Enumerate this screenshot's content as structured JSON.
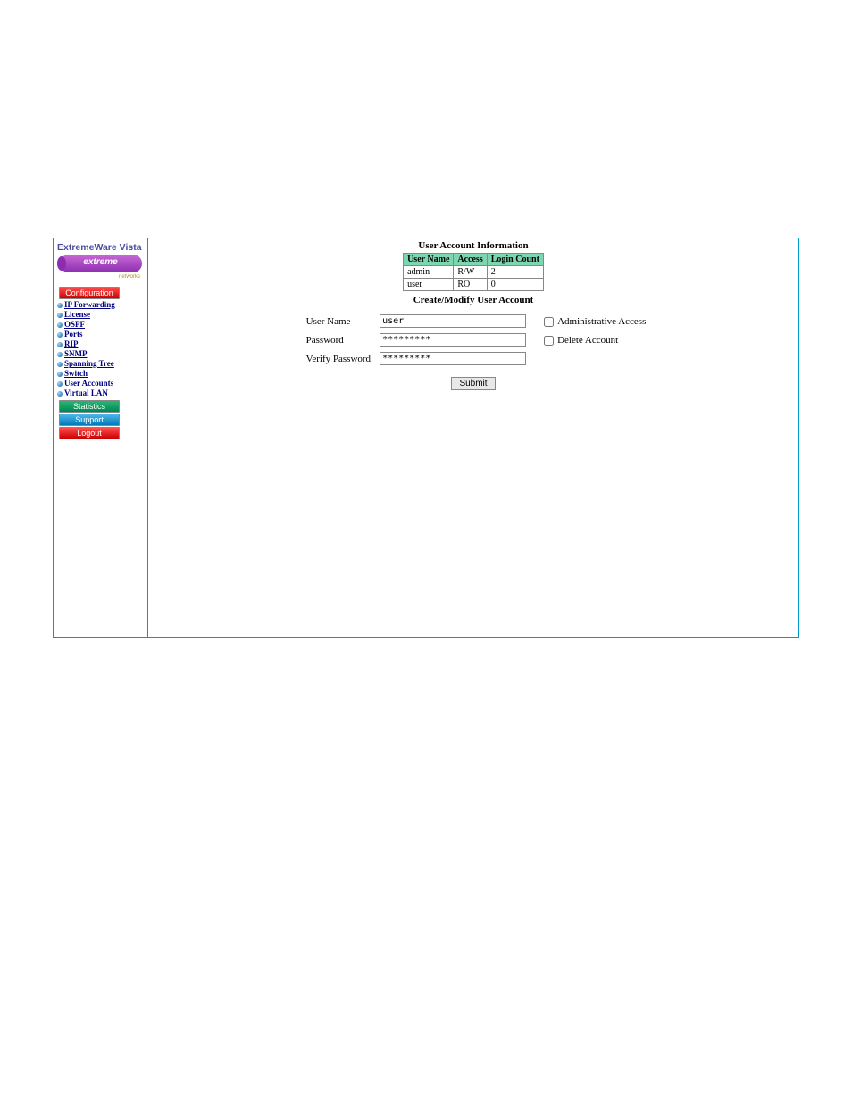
{
  "sidebar": {
    "app_title": "ExtremeWare Vista",
    "logo_text": "extreme",
    "logo_sub": "networks",
    "buttons": {
      "configuration": "Configuration",
      "statistics": "Statistics",
      "support": "Support",
      "logout": "Logout"
    },
    "items": [
      {
        "label": "IP Forwarding"
      },
      {
        "label": "License"
      },
      {
        "label": "OSPF"
      },
      {
        "label": "Ports"
      },
      {
        "label": "RIP"
      },
      {
        "label": "SNMP"
      },
      {
        "label": "Spanning Tree"
      },
      {
        "label": "Switch"
      },
      {
        "label": "User Accounts"
      },
      {
        "label": "Virtual LAN"
      }
    ]
  },
  "content": {
    "info_title": "User Account Information",
    "table": {
      "headers": {
        "user": "User Name",
        "access": "Access",
        "login": "Login Count"
      },
      "rows": [
        {
          "user": "admin",
          "access": "R/W",
          "login": "2"
        },
        {
          "user": "user",
          "access": "RO",
          "login": "0"
        }
      ]
    },
    "form_title": "Create/Modify User Account",
    "labels": {
      "username": "User Name",
      "password": "Password",
      "verify": "Verify Password",
      "admin_access": "Administrative Access",
      "delete_account": "Delete Account",
      "submit": "Submit"
    },
    "values": {
      "username": "user",
      "password": "*********",
      "verify": "*********",
      "admin_checked": false,
      "delete_checked": false
    }
  }
}
